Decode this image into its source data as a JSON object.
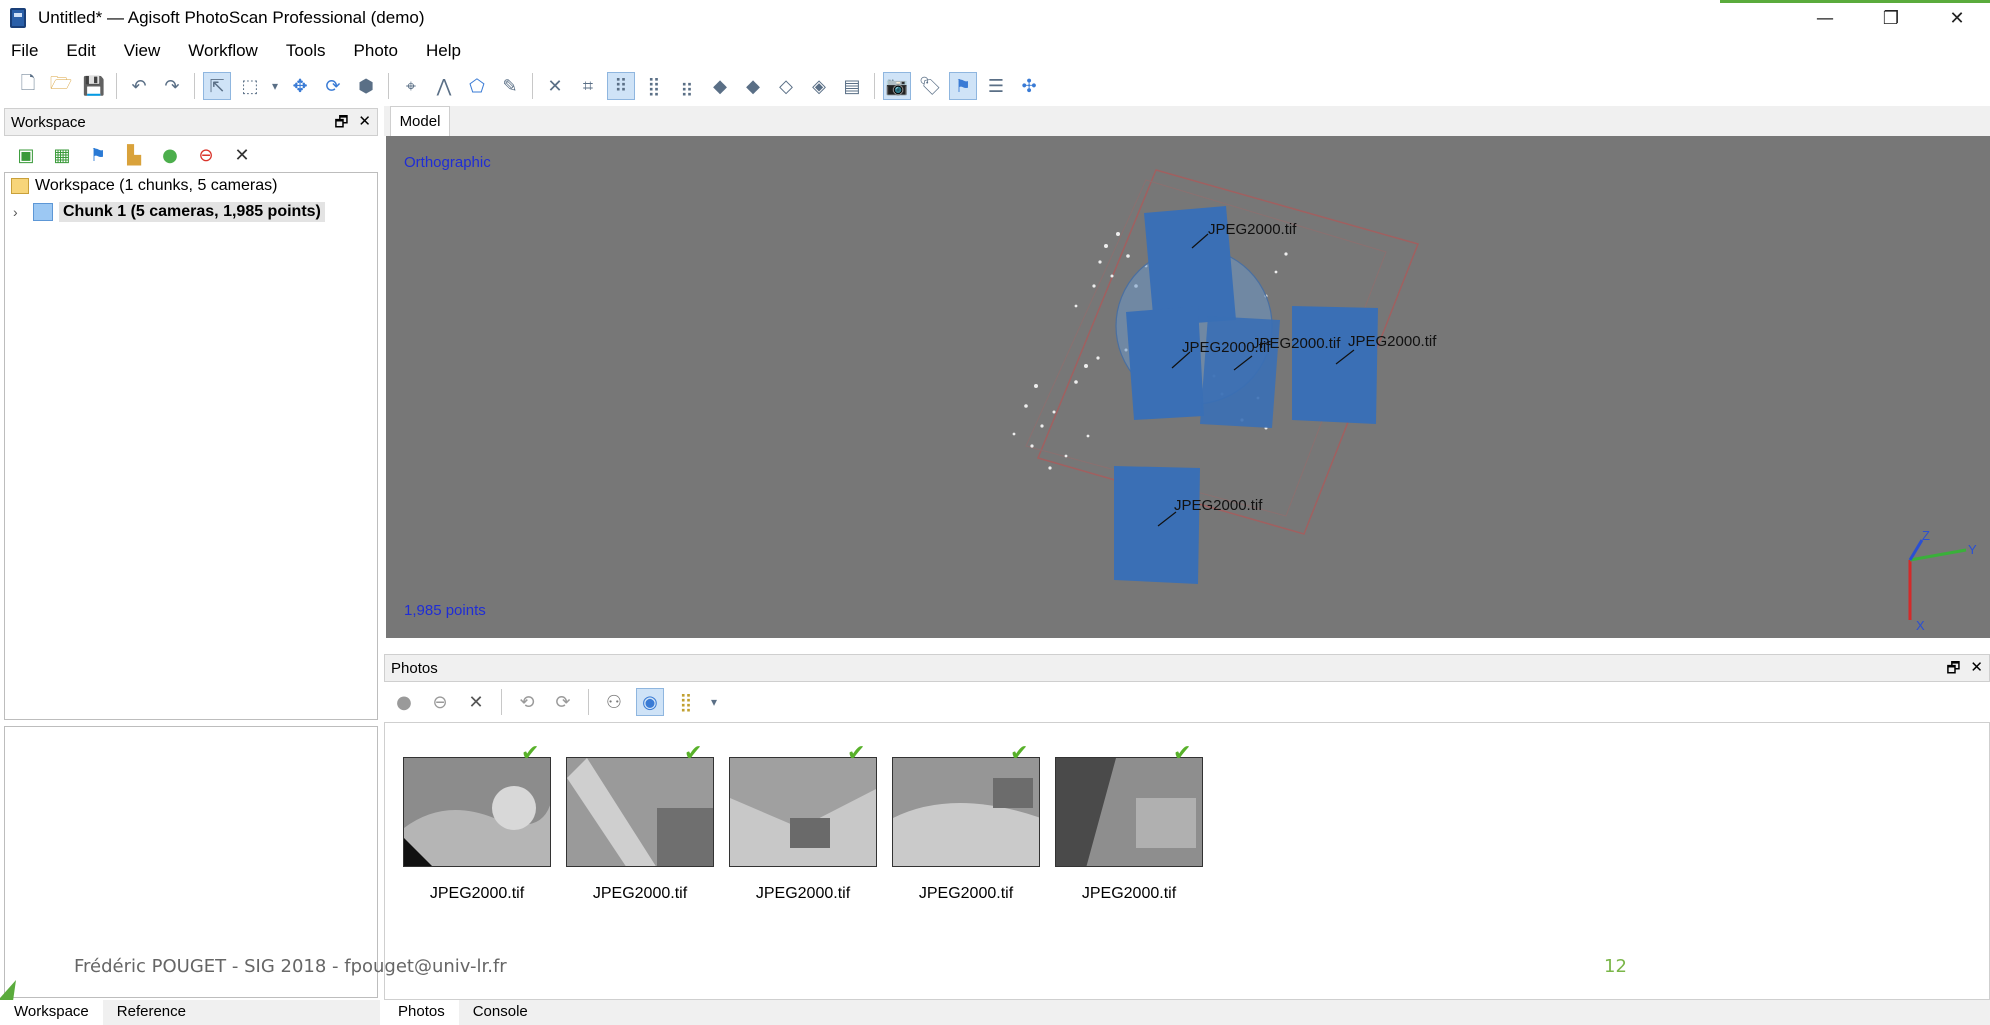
{
  "window": {
    "title": "Untitled* — Agisoft PhotoScan Professional (demo)",
    "controls": {
      "minimize": "—",
      "restore": "❐",
      "close": "✕"
    }
  },
  "menu": [
    "File",
    "Edit",
    "View",
    "Workflow",
    "Tools",
    "Photo",
    "Help"
  ],
  "toolbar_icons": [
    "new-icon",
    "open-icon",
    "save-icon",
    "undo-icon",
    "redo-icon",
    "select-icon",
    "rect-select-icon",
    "dropdown-icon",
    "navigation-icon",
    "rotate-icon",
    "model-icon",
    "point-icon",
    "ruler-icon",
    "shape-icon",
    "measure-icon",
    "delete-icon",
    "crop-icon",
    "grid-view-icon",
    "grid2-icon",
    "grid3-icon",
    "solid-icon",
    "shaded-icon",
    "wireframe-icon",
    "textured-icon",
    "dem-icon",
    "camera-icon",
    "tag-icon",
    "marker-flag-icon",
    "layers-icon",
    "move-icon"
  ],
  "workspace": {
    "header": "Workspace",
    "pane_controls": {
      "float": "🗗",
      "close": "✕"
    },
    "root": "Workspace (1 chunks, 5 cameras)",
    "chunk": "Chunk 1 (5 cameras, 1,985 points)"
  },
  "model": {
    "tab": "Model",
    "projection": "Orthographic",
    "points_label": "1,985 points",
    "camera_labels": [
      "JPEG2000.tif",
      "JPEG2000.tif",
      "JPEG2000.tif",
      "JPEG2000.tif",
      "JPEG2000.tif"
    ],
    "axes": {
      "z": "Z",
      "y": "Y",
      "x": "X"
    }
  },
  "photos": {
    "header": "Photos",
    "pane_controls": {
      "float": "🗗",
      "close": "✕"
    },
    "items": [
      {
        "label": "JPEG2000.tif",
        "status": "aligned"
      },
      {
        "label": "JPEG2000.tif",
        "status": "aligned"
      },
      {
        "label": "JPEG2000.tif",
        "status": "aligned"
      },
      {
        "label": "JPEG2000.tif",
        "status": "aligned"
      },
      {
        "label": "JPEG2000.tif",
        "status": "aligned"
      }
    ]
  },
  "bottom_tabs_left": [
    "Workspace",
    "Reference"
  ],
  "bottom_tabs_right": [
    "Photos",
    "Console"
  ],
  "footer": {
    "author": "Frédéric POUGET - SIG 2018 - fpouget@univ-lr.fr",
    "page": "12"
  },
  "colors": {
    "viewport": "#777777",
    "camera_plane": "#3a6fb5",
    "accent_green": "#5aab3c"
  }
}
